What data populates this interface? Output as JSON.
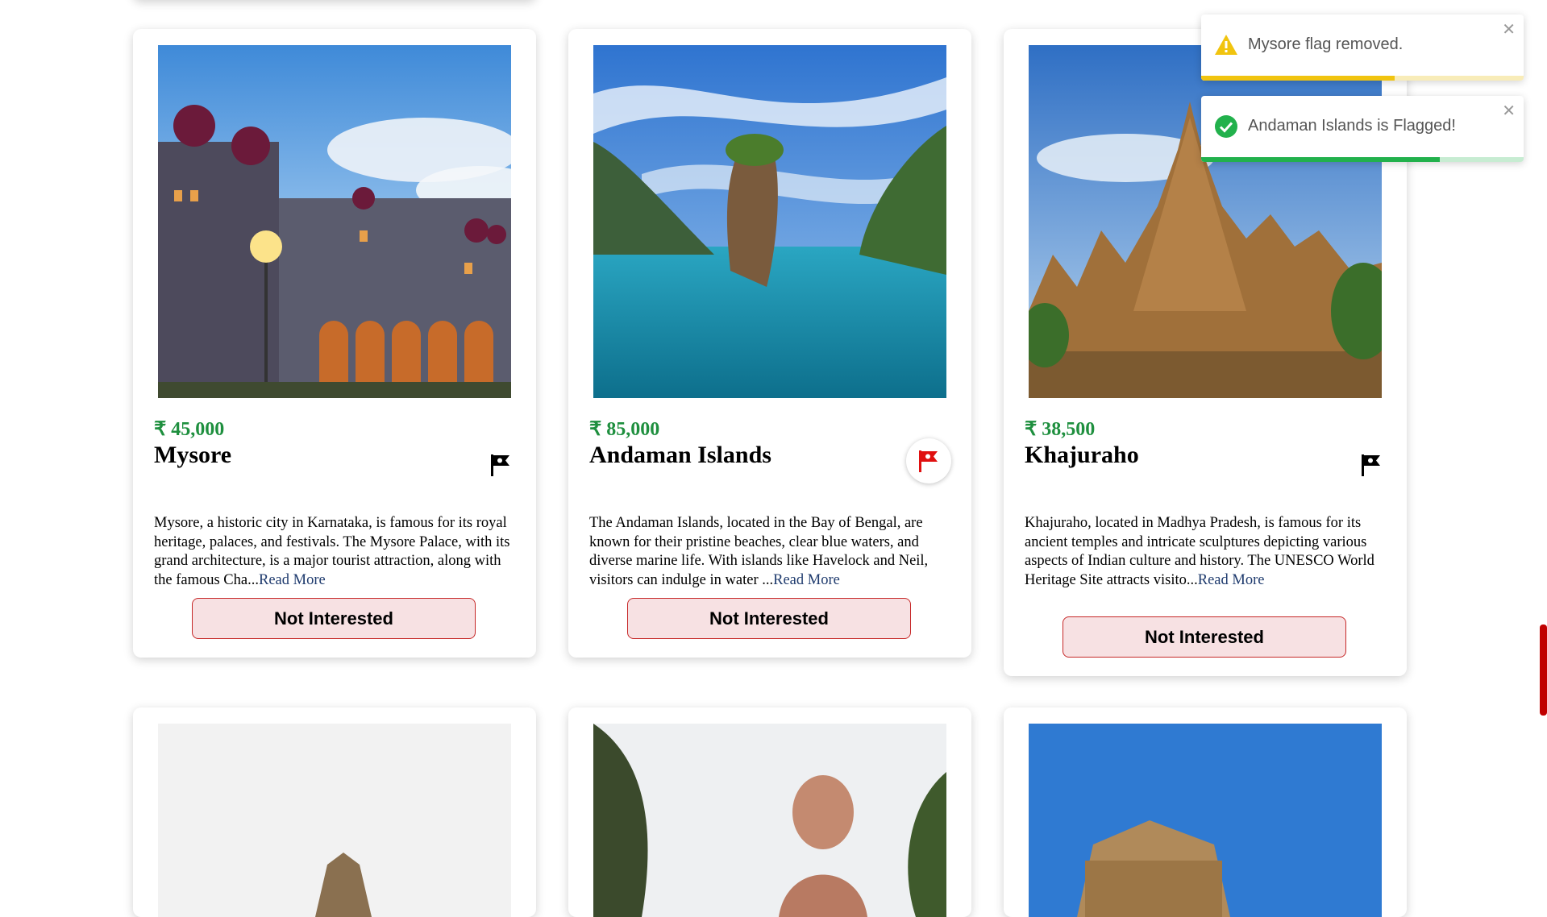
{
  "cards": [
    {
      "price": "₹ 45,000",
      "title": "Mysore",
      "description": "Mysore, a historic city in Karnataka, is famous for its royal heritage, palaces, and festivals. The Mysore Palace, with its grand architecture, is a major tourist attraction, along with the famous Cha...",
      "read_more": "Read More",
      "button_label": "Not Interested",
      "flagged": false
    },
    {
      "price": "₹ 85,000",
      "title": "Andaman Islands",
      "description": "The Andaman Islands, located in the Bay of Bengal, are known for their pristine beaches, clear blue waters, and diverse marine life. With islands like Havelock and Neil, visitors can indulge in water ...",
      "read_more": "Read More",
      "button_label": "Not Interested",
      "flagged": true
    },
    {
      "price": "₹ 38,500",
      "title": "Khajuraho",
      "description": "Khajuraho, located in Madhya Pradesh, is famous for its ancient temples and intricate sculptures depicting various aspects of Indian culture and history. The UNESCO World Heritage Site attracts visito...",
      "read_more": "Read More",
      "button_label": "Not Interested",
      "flagged": false
    }
  ],
  "toasts": [
    {
      "type": "warning",
      "icon": "warning-icon",
      "message": "Mysore flag removed.",
      "progress": 0.6,
      "color": "#f1c40f"
    },
    {
      "type": "success",
      "icon": "check-circle-icon",
      "message": "Andaman Islands is Flagged!",
      "progress": 0.74,
      "color": "#22b14c"
    }
  ],
  "colors": {
    "price": "#1e8f3e",
    "flag_active": "#e01010",
    "button_bg": "#f7e1e3",
    "button_border": "#c62828",
    "scrollbar": "#c00000"
  }
}
